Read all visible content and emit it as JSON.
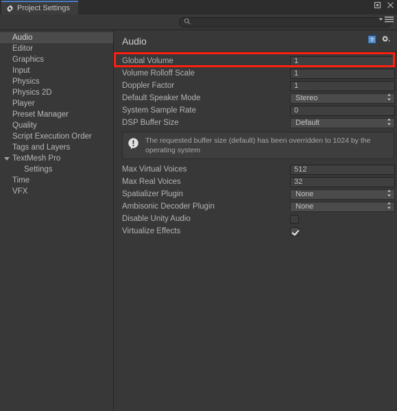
{
  "window": {
    "tab_label": "Project Settings",
    "tab_icon": "gear-icon",
    "controls": {
      "maximize": "maximize-icon",
      "close": "close-icon",
      "menu": "panel-menu-icon"
    }
  },
  "search": {
    "value": "",
    "placeholder": "",
    "icon": "search-icon"
  },
  "sidebar": {
    "items": [
      {
        "label": "Audio",
        "selected": true,
        "indent": "normal"
      },
      {
        "label": "Editor",
        "selected": false,
        "indent": "normal"
      },
      {
        "label": "Graphics",
        "selected": false,
        "indent": "normal"
      },
      {
        "label": "Input",
        "selected": false,
        "indent": "normal"
      },
      {
        "label": "Physics",
        "selected": false,
        "indent": "normal"
      },
      {
        "label": "Physics 2D",
        "selected": false,
        "indent": "normal"
      },
      {
        "label": "Player",
        "selected": false,
        "indent": "normal"
      },
      {
        "label": "Preset Manager",
        "selected": false,
        "indent": "normal"
      },
      {
        "label": "Quality",
        "selected": false,
        "indent": "normal"
      },
      {
        "label": "Script Execution Order",
        "selected": false,
        "indent": "normal"
      },
      {
        "label": "Tags and Layers",
        "selected": false,
        "indent": "normal"
      },
      {
        "label": "TextMesh Pro",
        "selected": false,
        "indent": "parent",
        "expanded": true
      },
      {
        "label": "Settings",
        "selected": false,
        "indent": "child"
      },
      {
        "label": "Time",
        "selected": false,
        "indent": "normal"
      },
      {
        "label": "VFX",
        "selected": false,
        "indent": "normal"
      }
    ]
  },
  "main": {
    "title": "Audio",
    "help_icon": "help-book-icon",
    "settings_icon": "gear-dropdown-icon",
    "rows_top": [
      {
        "label": "Global Volume",
        "type": "text",
        "value": "1",
        "highlighted": true
      },
      {
        "label": "Volume Rolloff Scale",
        "type": "text",
        "value": "1"
      },
      {
        "label": "Doppler Factor",
        "type": "text",
        "value": "1"
      },
      {
        "label": "Default Speaker Mode",
        "type": "popup",
        "value": "Stereo"
      },
      {
        "label": "System Sample Rate",
        "type": "text",
        "value": "0"
      },
      {
        "label": "DSP Buffer Size",
        "type": "popup",
        "value": "Default"
      }
    ],
    "info": {
      "icon": "info-exclamation-icon",
      "text": "The requested buffer size (default) has been overridden to 1024 by the operating system"
    },
    "rows_bottom": [
      {
        "label": "Max Virtual Voices",
        "type": "text",
        "value": "512"
      },
      {
        "label": "Max Real Voices",
        "type": "text",
        "value": "32"
      },
      {
        "label": "Spatializer Plugin",
        "type": "popup",
        "value": "None"
      },
      {
        "label": "Ambisonic Decoder Plugin",
        "type": "popup",
        "value": "None"
      },
      {
        "label": "Disable Unity Audio",
        "type": "checkbox",
        "value": false
      },
      {
        "label": "Virtualize Effects",
        "type": "checkbox",
        "value": true
      }
    ]
  },
  "colors": {
    "background": "#383838",
    "tab_accent": "#4a7ec4",
    "highlight_box": "#ff1f10",
    "selection": "#4b4b4b"
  }
}
